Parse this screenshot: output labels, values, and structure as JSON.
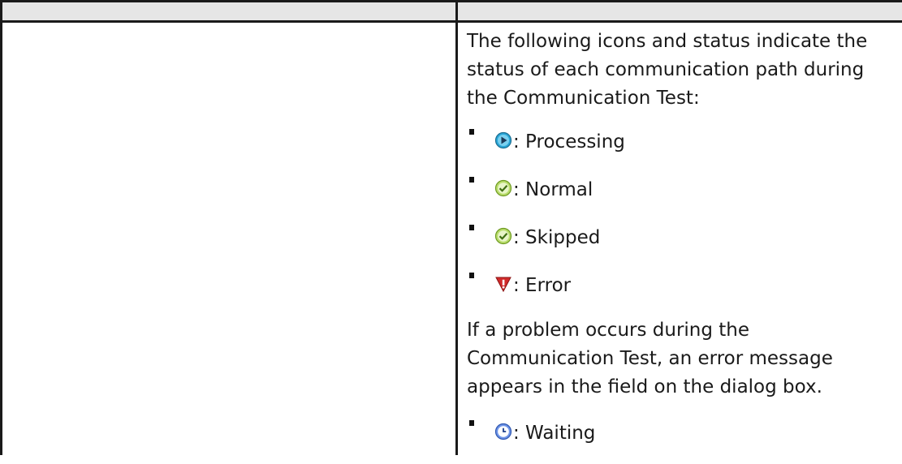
{
  "intro_text": "The following icons and status indicate the status of each communication path during the Communication Test:",
  "statuses": [
    {
      "icon": "processing-icon",
      "label": ": Processing"
    },
    {
      "icon": "normal-icon",
      "label": ": Normal"
    },
    {
      "icon": "skipped-icon",
      "label": ": Skipped"
    },
    {
      "icon": "error-icon",
      "label": ": Error"
    }
  ],
  "problem_text": "If a problem occurs during the Communication Test, an error message appears in the field on the dialog box.",
  "waiting": {
    "icon": "waiting-icon",
    "label": ": Waiting"
  },
  "colors": {
    "processing": "#2aa7d8",
    "normal": "#8cc63f",
    "error": "#d22b2b",
    "waiting": "#3b6fd1",
    "header_bg": "#e6e6e6"
  }
}
